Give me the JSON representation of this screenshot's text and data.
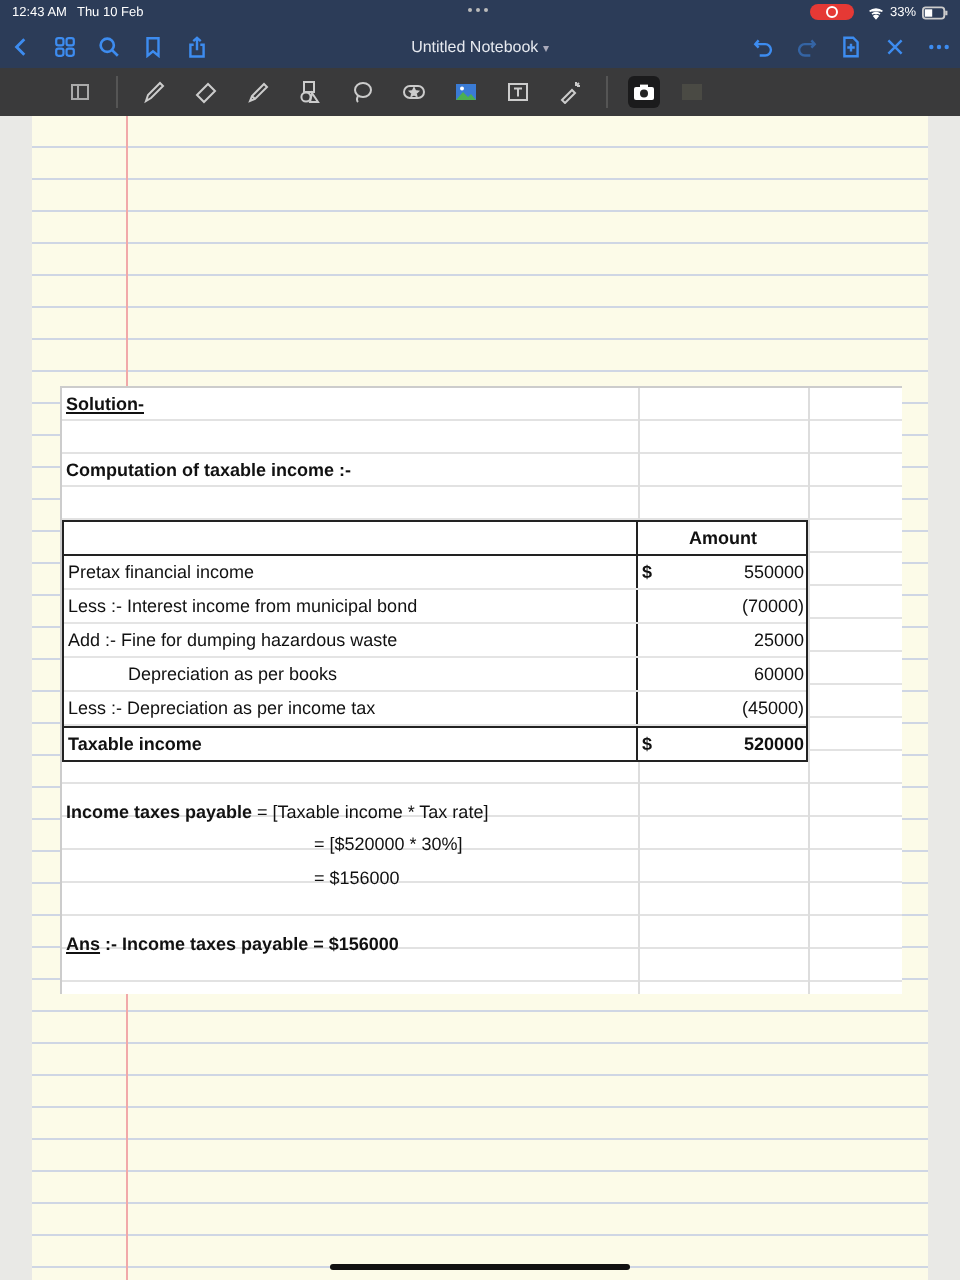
{
  "status_bar": {
    "time": "12:43 AM",
    "date": "Thu 10 Feb",
    "battery": "33%",
    "recording": true
  },
  "nav": {
    "title": "Untitled Notebook",
    "caret": "▾"
  },
  "toolbar": {
    "tools": [
      {
        "kind": "reader",
        "selected": false
      },
      {
        "kind": "pen",
        "selected": false
      },
      {
        "kind": "eraser",
        "selected": false
      },
      {
        "kind": "highlighter",
        "selected": false
      },
      {
        "kind": "shapes",
        "selected": false
      },
      {
        "kind": "lasso",
        "selected": false
      },
      {
        "kind": "sticker",
        "selected": false
      },
      {
        "kind": "image",
        "selected": false
      },
      {
        "kind": "text",
        "selected": false
      },
      {
        "kind": "laser",
        "selected": false
      },
      {
        "kind": "camera",
        "selected": true
      }
    ]
  },
  "sheet": {
    "title": "Solution-",
    "subtitle": "Computation of taxable income :-",
    "amount_header": "Amount",
    "rows": [
      {
        "kind": "normal",
        "label": "Pretax financial income",
        "currency": "$",
        "amount": "550000"
      },
      {
        "kind": "normal",
        "label": "Less :- Interest income from municipal bond",
        "amount": "(70000)"
      },
      {
        "kind": "normal",
        "label": "Add :- Fine for dumping hazardous waste",
        "amount": "25000"
      },
      {
        "kind": "indent",
        "label": "Depreciation as per books",
        "amount": "60000"
      },
      {
        "kind": "normal",
        "label": "Less :- Depreciation as per income tax",
        "amount": "(45000)"
      },
      {
        "kind": "total",
        "label": "Taxable income",
        "currency": "$",
        "amount": "520000"
      }
    ],
    "calculation": [
      {
        "kind": "lead",
        "text": "**Income taxes payable** = [Taxable income * Tax rate]"
      },
      {
        "kind": "cont",
        "text": "= [$520000 * 30%]"
      },
      {
        "kind": "cont",
        "text": "= $156000"
      }
    ],
    "answer": {
      "label": "Ans",
      "text": ":- Income taxes payable = $156000"
    }
  }
}
